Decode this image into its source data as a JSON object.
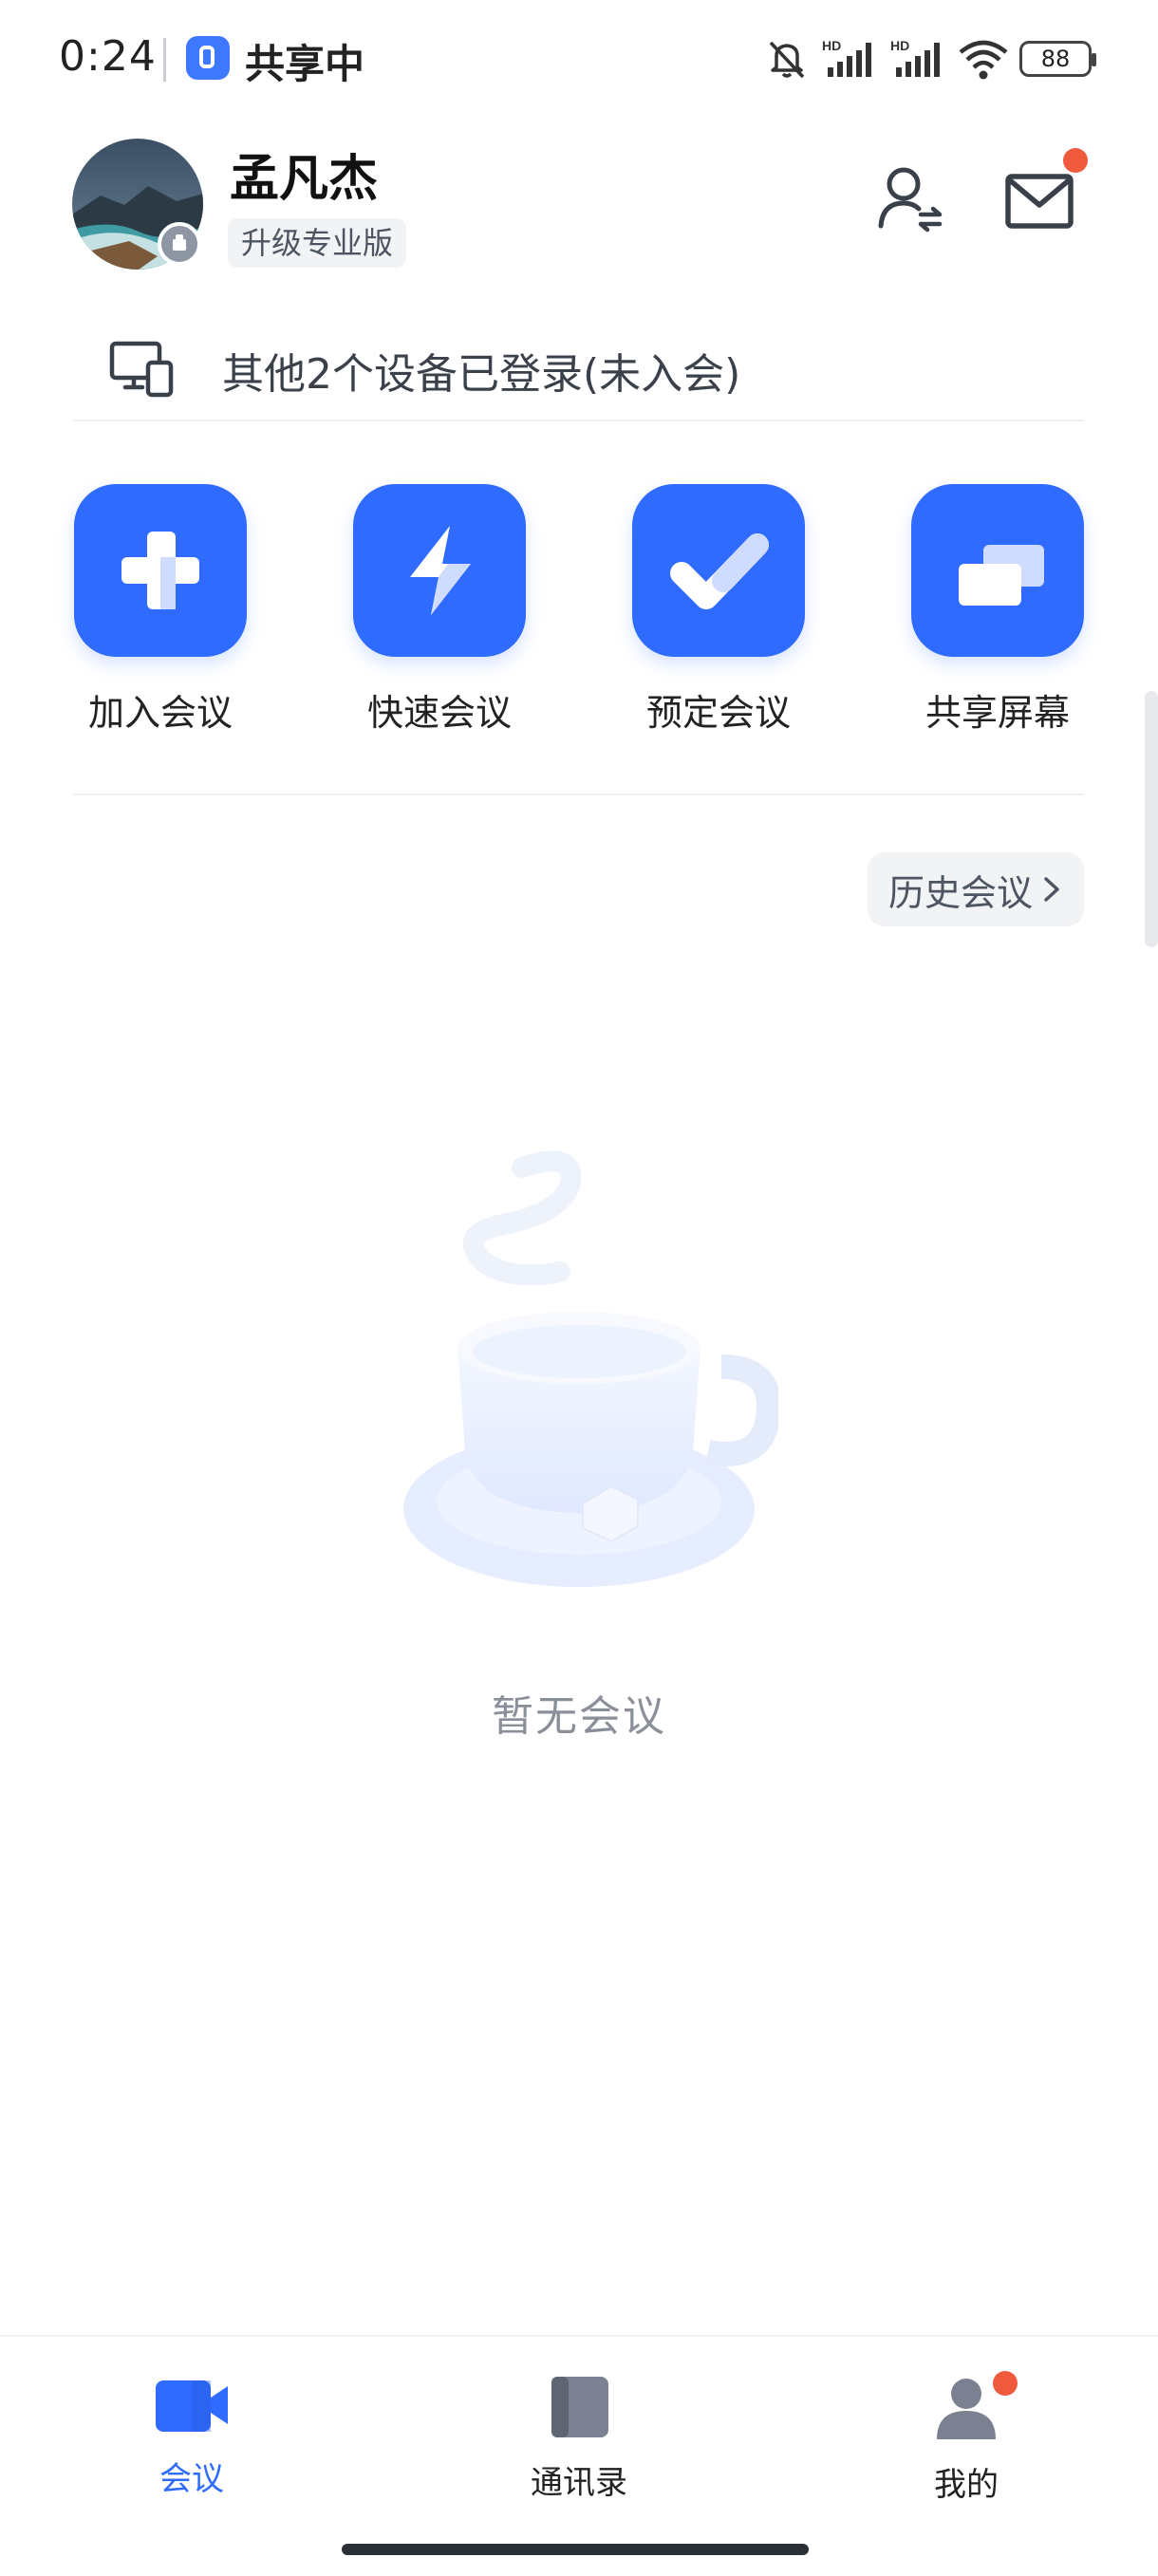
{
  "status_bar": {
    "time": "0:24",
    "app_status": "共享中",
    "battery": "88"
  },
  "profile": {
    "name": "孟凡杰",
    "upgrade_label": "升级专业版"
  },
  "devices_notice": "其他2个设备已登录(未入会)",
  "actions": [
    {
      "label": "加入会议",
      "icon": "plus-icon"
    },
    {
      "label": "快速会议",
      "icon": "lightning-icon"
    },
    {
      "label": "预定会议",
      "icon": "check-icon"
    },
    {
      "label": "共享屏幕",
      "icon": "screen-share-icon"
    }
  ],
  "history_button": "历史会议",
  "empty_state": "暂无会议",
  "bottom_nav": [
    {
      "label": "会议",
      "icon": "video-camera-icon",
      "active": true
    },
    {
      "label": "通讯录",
      "icon": "contacts-book-icon",
      "active": false
    },
    {
      "label": "我的",
      "icon": "person-icon",
      "active": false
    }
  ],
  "colors": {
    "accent": "#2f6bff",
    "badge": "#f05a3c"
  }
}
